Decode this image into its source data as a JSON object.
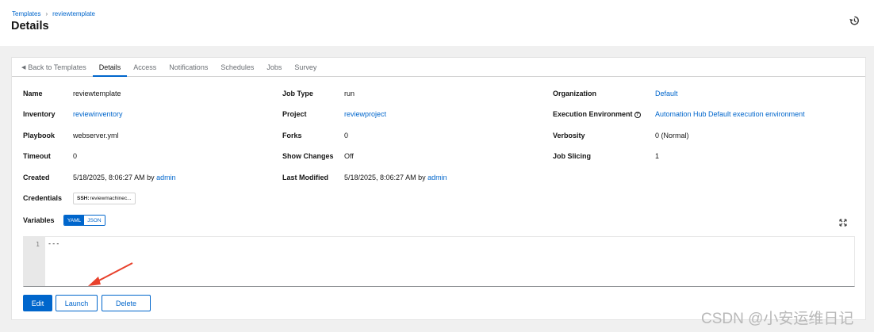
{
  "breadcrumb": {
    "parent": "Templates",
    "current": "reviewtemplate"
  },
  "header": {
    "title": "Details",
    "history_icon": "history-icon"
  },
  "tabs": [
    {
      "label": "Back to Templates"
    },
    {
      "label": "Details"
    },
    {
      "label": "Access"
    },
    {
      "label": "Notifications"
    },
    {
      "label": "Schedules"
    },
    {
      "label": "Jobs"
    },
    {
      "label": "Survey"
    }
  ],
  "details": {
    "name": {
      "label": "Name",
      "value": "reviewtemplate"
    },
    "job_type": {
      "label": "Job Type",
      "value": "run"
    },
    "organization": {
      "label": "Organization",
      "value": "Default"
    },
    "inventory": {
      "label": "Inventory",
      "value": "reviewinventory"
    },
    "project": {
      "label": "Project",
      "value": "reviewproject"
    },
    "execution_environment": {
      "label": "Execution Environment",
      "value": "Automation Hub Default execution environment",
      "help_glyph": "?"
    },
    "playbook": {
      "label": "Playbook",
      "value": "webserver.yml"
    },
    "forks": {
      "label": "Forks",
      "value": "0"
    },
    "verbosity": {
      "label": "Verbosity",
      "value": "0 (Normal)"
    },
    "timeout": {
      "label": "Timeout",
      "value": "0"
    },
    "show_changes": {
      "label": "Show Changes",
      "value": "Off"
    },
    "job_slicing": {
      "label": "Job Slicing",
      "value": "1"
    },
    "created": {
      "label": "Created",
      "value": "5/18/2025, 8:06:27 AM by",
      "user": "admin"
    },
    "last_modified": {
      "label": "Last Modified",
      "value": "5/18/2025, 8:06:27 AM by",
      "user": "admin"
    },
    "credentials": {
      "label": "Credentials",
      "chip_type": "SSH:",
      "chip_name": "reviewmachinec..."
    },
    "variables": {
      "label": "Variables",
      "format_options": [
        "YAML",
        "JSON"
      ],
      "selected_format": "YAML"
    }
  },
  "editor": {
    "line_number": "1",
    "content": "---"
  },
  "actions": {
    "edit": "Edit",
    "launch": "Launch",
    "delete": "Delete"
  },
  "watermark": "CSDN @小安运维日记",
  "colors": {
    "primary": "#0066cc",
    "annotation_arrow": "#e8412c"
  }
}
